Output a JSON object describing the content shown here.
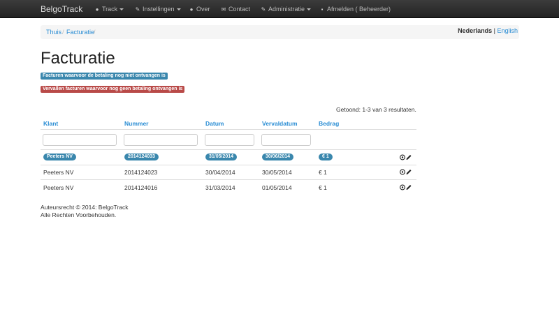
{
  "navbar": {
    "brand": "BelgoTrack",
    "items": [
      {
        "label": "Track",
        "icon": "globe-icon",
        "dropdown": true
      },
      {
        "label": "Instellingen",
        "icon": "wrench-icon",
        "dropdown": true
      },
      {
        "label": "Over",
        "icon": "question-circle-icon",
        "dropdown": false
      },
      {
        "label": "Contact",
        "icon": "envelope-icon",
        "dropdown": false
      },
      {
        "label": "Administratie",
        "icon": "wrench-icon",
        "dropdown": true
      },
      {
        "label": "Afmelden ( Beheerder)",
        "icon": "lock-icon",
        "dropdown": false
      }
    ]
  },
  "breadcrumb": {
    "items": [
      "Thuis",
      "Facturatie"
    ],
    "separator": "/"
  },
  "language": {
    "current": "Nederlands",
    "separator": "|",
    "other": "English"
  },
  "page": {
    "title": "Facturatie",
    "legend_unpaid": "Facturen waarvoor de betaling nog niet ontvangen is",
    "legend_overdue": "Vervallen facturen waarvoor nog geen betaling ontvangen is"
  },
  "table": {
    "summary": "Getoond: 1-3 van 3 resultaten.",
    "headers": [
      "Klant",
      "Nummer",
      "Datum",
      "Vervaldatum",
      "Bedrag"
    ],
    "filters": [
      "",
      "",
      "",
      ""
    ],
    "rows": [
      {
        "klant": "Peeters NV",
        "nummer": "2014124033",
        "datum": "31/05/2014",
        "vervaldatum": "30/06/2014",
        "bedrag": "€ 1",
        "status": "unpaid"
      },
      {
        "klant": "Peeters NV",
        "nummer": "2014124023",
        "datum": "30/04/2014",
        "vervaldatum": "30/05/2014",
        "bedrag": "€ 1",
        "status": "paid"
      },
      {
        "klant": "Peeters NV",
        "nummer": "2014124016",
        "datum": "31/03/2014",
        "vervaldatum": "01/05/2014",
        "bedrag": "€ 1",
        "status": "paid"
      }
    ]
  },
  "footer": {
    "line1": "Auteursrecht © 2014: BelgoTrack",
    "line2": "Alle Rechten Voorbehouden."
  },
  "colors": {
    "unpaid": "#3a87ad",
    "overdue": "#b94a48",
    "link": "#2a8dd4"
  }
}
